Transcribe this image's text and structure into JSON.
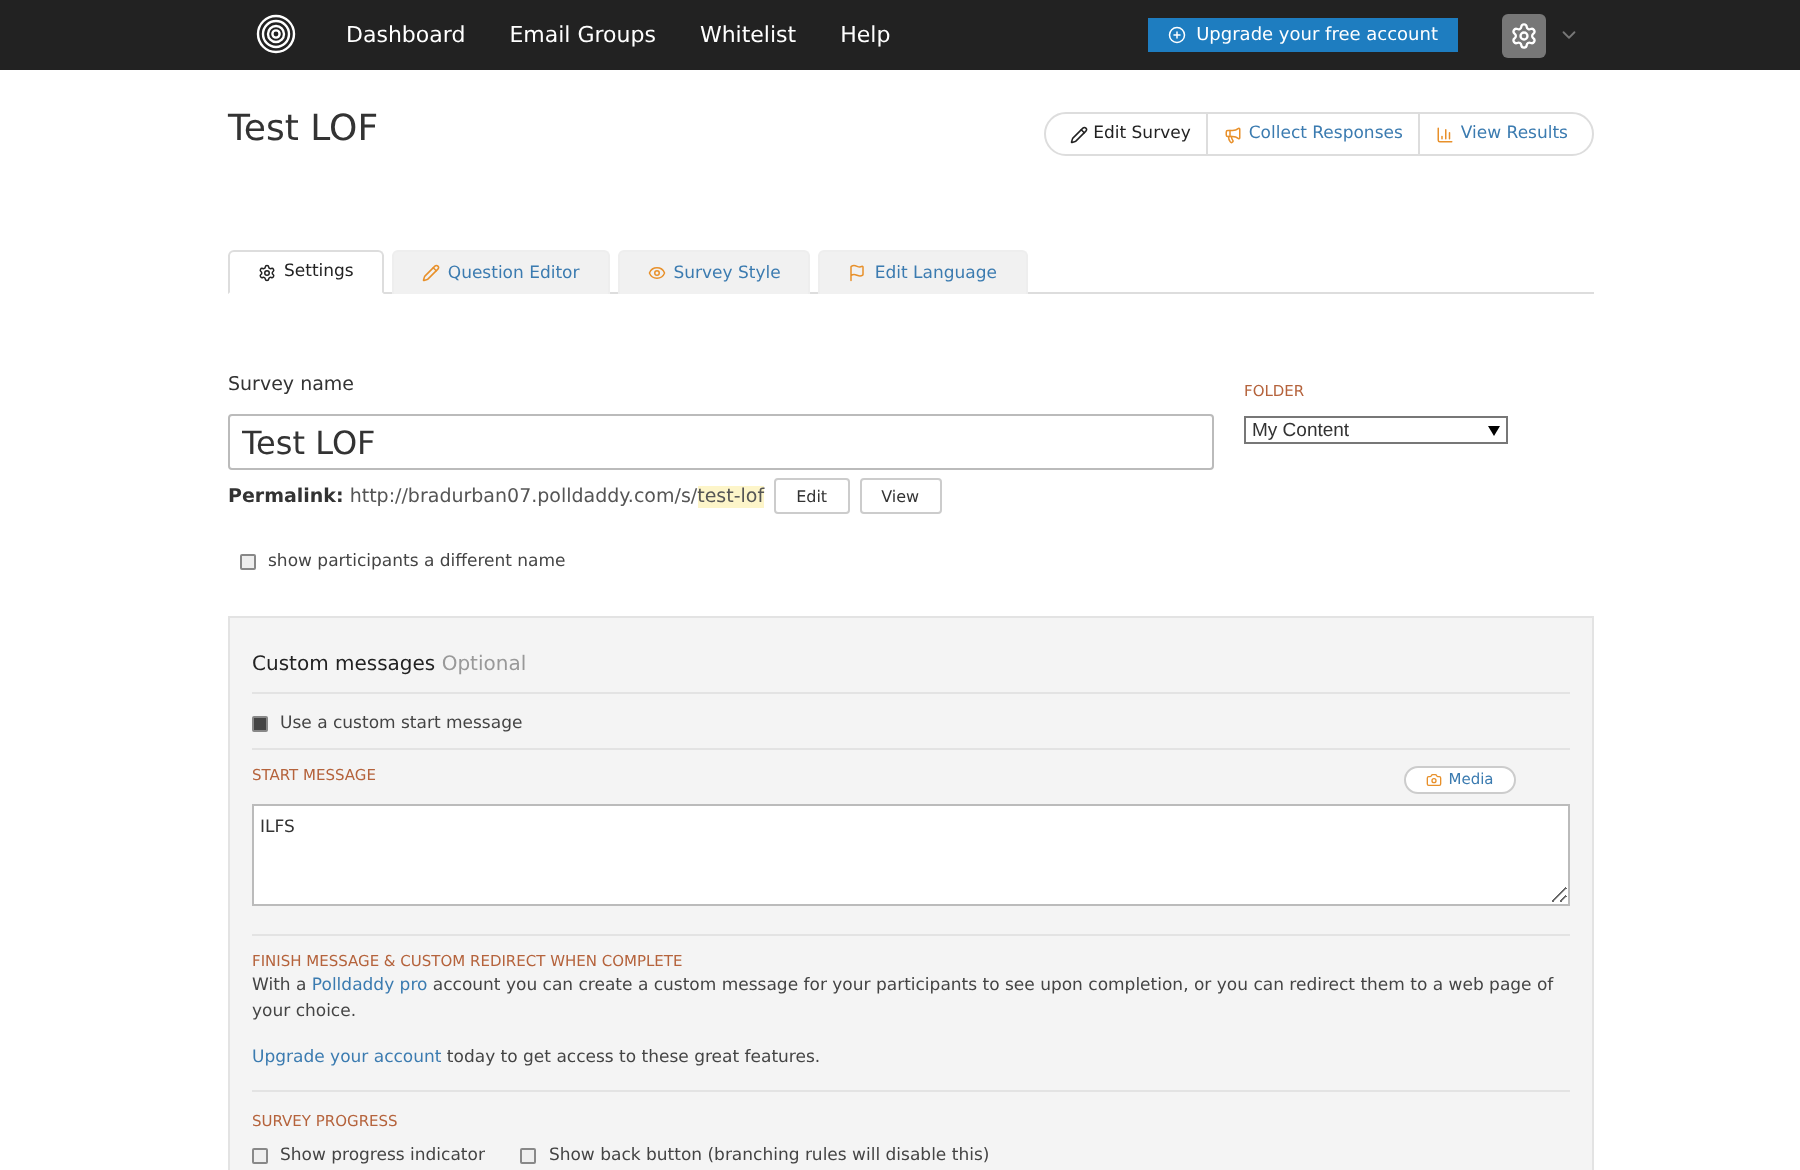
{
  "nav": {
    "items": [
      "Dashboard",
      "Email Groups",
      "Whitelist",
      "Help"
    ],
    "upgrade": "Upgrade your free account"
  },
  "title": "Test LOF",
  "actions": [
    {
      "label": "Edit Survey",
      "kind": "edit"
    },
    {
      "label": "Collect Responses",
      "kind": "collect"
    },
    {
      "label": "View Results",
      "kind": "results"
    }
  ],
  "tabs": [
    {
      "label": "Settings",
      "kind": "settings",
      "selected": true
    },
    {
      "label": "Question Editor",
      "kind": "editor",
      "selected": false
    },
    {
      "label": "Survey Style",
      "kind": "style",
      "selected": false
    },
    {
      "label": "Edit Language",
      "kind": "language",
      "selected": false
    }
  ],
  "survey_name": {
    "label": "Survey name",
    "value": "Test LOF"
  },
  "folder": {
    "label": "FOLDER",
    "value": "My Content"
  },
  "permalink": {
    "label": "Permalink:",
    "url": "http://bradurban07.polldaddy.com/s/",
    "slug": "test-lof",
    "buttons": [
      "Edit",
      "View"
    ]
  },
  "alias": {
    "label": "show participants a different name",
    "checked": false
  },
  "custom_messages": {
    "title": "Custom messages",
    "optional": "Optional",
    "start_toggle": {
      "label": "Use a custom start message",
      "checked": true
    },
    "start_label": "START MESSAGE",
    "media": "Media",
    "start_value": "ILFS",
    "finish_label": "FINISH MESSAGE & CUSTOM REDIRECT WHEN COMPLETE",
    "finish_before": "With a ",
    "finish_link": "Polldaddy pro",
    "finish_after": " account you can create a custom message for your participants to see upon completion, or you can redirect them to a web page of your choice.",
    "upgrade_link": "Upgrade your account",
    "upgrade_after": " today to get access to these great features.",
    "progress_label": "SURVEY PROGRESS",
    "progress_options": [
      {
        "label": "Show progress indicator",
        "checked": false
      },
      {
        "label": "Show back button (branching rules will disable this)",
        "checked": false
      }
    ]
  }
}
